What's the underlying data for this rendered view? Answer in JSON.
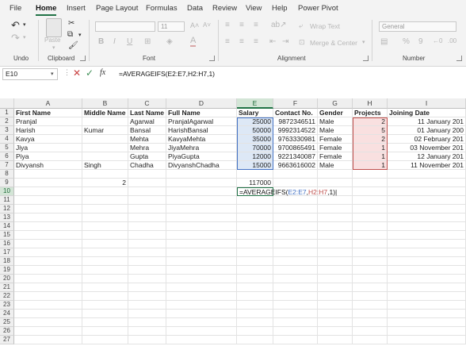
{
  "menu_tabs": [
    "File",
    "Home",
    "Insert",
    "Page Layout",
    "Formulas",
    "Data",
    "Review",
    "View",
    "Help",
    "Power Pivot"
  ],
  "active_tab": "Home",
  "ribbon": {
    "undo_label": "Undo",
    "clipboard_label": "Clipboard",
    "paste_label": "Paste",
    "font_label": "Font",
    "font_size": "11",
    "alignment_label": "Alignment",
    "wrap_text": "Wrap Text",
    "merge_center": "Merge & Center",
    "number_label": "Number",
    "number_format": "General",
    "bold": "B",
    "italic": "I",
    "underline": "U"
  },
  "formula_bar": {
    "name_box": "E10",
    "fx": "fx",
    "formula": "=AVERAGEIFS(E2:E7,H2:H7,1)"
  },
  "columns": [
    "A",
    "B",
    "C",
    "D",
    "E",
    "F",
    "G",
    "H",
    "I"
  ],
  "rows": [
    "1",
    "2",
    "3",
    "4",
    "5",
    "6",
    "7",
    "8",
    "9",
    "10",
    "11",
    "12",
    "13",
    "14",
    "15",
    "16",
    "17",
    "18",
    "19",
    "20",
    "21",
    "22",
    "23",
    "24",
    "25",
    "26",
    "27"
  ],
  "table": {
    "headers": [
      "First Name",
      "Middle Name",
      "Last Name",
      "Full Name",
      "Salary",
      "Contact No.",
      "Gender",
      "Projects",
      "Joining Date"
    ],
    "rows": [
      [
        "Pranjal",
        "",
        "Agarwal",
        "PranjalAgarwal",
        "25000",
        "9872346511",
        "Male",
        "2",
        "11 January 201"
      ],
      [
        "Harish",
        "Kumar",
        "Bansal",
        "HarishBansal",
        "50000",
        "9992314522",
        "Male",
        "5",
        "01 January 200"
      ],
      [
        "Kavya",
        "",
        "Mehta",
        "KavyaMehta",
        "35000",
        "9763330981",
        "Female",
        "2",
        "02 February 201"
      ],
      [
        "Jiya",
        "",
        "Mehra",
        "JiyaMehra",
        "70000",
        "9700865491",
        "Female",
        "1",
        "03 November 201"
      ],
      [
        "Piya",
        "",
        "Gupta",
        "PiyaGupta",
        "12000",
        "9221340087",
        "Female",
        "1",
        "12 January 201"
      ],
      [
        "Divyansh",
        "Singh",
        "Chadha",
        "DivyanshChadha",
        "15000",
        "9663616002",
        "Male",
        "1",
        "11 November 201"
      ]
    ],
    "b9": "2",
    "e9": "117000",
    "e10_parts": {
      "prefix": "=AVERAGEIFS(",
      "range1": "E2:E7",
      "comma1": ",",
      "range2": "H2:H7",
      "suffix": ",1)"
    }
  },
  "colors": {
    "excel_green": "#217346",
    "range1_blue": "#4472c4",
    "range2_red": "#c0504d"
  }
}
